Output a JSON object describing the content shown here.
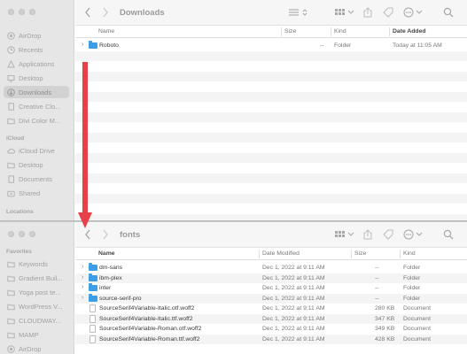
{
  "colors": {
    "accent": "#3d9de6",
    "arrow": "#e8404a",
    "selected_bg": "#d2d2d2"
  },
  "window1": {
    "title": "Downloads",
    "sidebar": {
      "items": [
        {
          "label": "AirDrop",
          "icon": "airdrop-icon"
        },
        {
          "label": "Recents",
          "icon": "clock-icon"
        },
        {
          "label": "Applications",
          "icon": "applications-icon"
        },
        {
          "label": "Desktop",
          "icon": "desktop-icon"
        },
        {
          "label": "Downloads",
          "icon": "download-icon",
          "selected": true
        },
        {
          "label": "Creative Clo...",
          "icon": "document-icon"
        },
        {
          "label": "Divi Color M...",
          "icon": "folder-icon"
        }
      ],
      "icloud_header": "iCloud",
      "icloud_items": [
        {
          "label": "iCloud Drive",
          "icon": "cloud-icon"
        },
        {
          "label": "Desktop",
          "icon": "folder-icon"
        },
        {
          "label": "Documents",
          "icon": "document-icon"
        },
        {
          "label": "Shared",
          "icon": "shared-folder-icon"
        }
      ],
      "locations_header": "Locations"
    },
    "columns": {
      "name": "Name",
      "size": "Size",
      "kind": "Kind",
      "date_added": "Date Added"
    },
    "rows": [
      {
        "name": "Roboto",
        "size": "--",
        "kind": "Folder",
        "date": "Today at 11:05 AM",
        "type": "folder"
      }
    ]
  },
  "window2": {
    "title": "fonts",
    "sidebar": {
      "favorites_header": "Favorites",
      "items": [
        {
          "label": "Keywords",
          "icon": "folder-icon"
        },
        {
          "label": "Gradient Buil...",
          "icon": "folder-icon"
        },
        {
          "label": "Yoga post te...",
          "icon": "folder-icon"
        },
        {
          "label": "WordPress V...",
          "icon": "folder-icon"
        },
        {
          "label": "CLOUDWAY...",
          "icon": "folder-icon"
        },
        {
          "label": "MAMP",
          "icon": "folder-icon"
        },
        {
          "label": "AirDrop",
          "icon": "airdrop-icon"
        }
      ]
    },
    "columns": {
      "name": "Name",
      "date_modified": "Date Modified",
      "size": "Size",
      "kind": "Kind"
    },
    "rows": [
      {
        "name": "dm-sans",
        "date": "Dec 1, 2022 at 9:11 AM",
        "size": "--",
        "kind": "Folder",
        "type": "folder"
      },
      {
        "name": "ibm-plex",
        "date": "Dec 1, 2022 at 9:11 AM",
        "size": "--",
        "kind": "Folder",
        "type": "folder"
      },
      {
        "name": "inter",
        "date": "Dec 1, 2022 at 9:11 AM",
        "size": "--",
        "kind": "Folder",
        "type": "folder"
      },
      {
        "name": "source-serif-pro",
        "date": "Dec 1, 2022 at 9:11 AM",
        "size": "--",
        "kind": "Folder",
        "type": "folder"
      },
      {
        "name": "SourceSerif4Variable-Italic.otf.woff2",
        "date": "Dec 1, 2022 at 9:11 AM",
        "size": "280 KB",
        "kind": "Document",
        "type": "doc"
      },
      {
        "name": "SourceSerif4Variable-Italic.ttf.woff2",
        "date": "Dec 1, 2022 at 9:11 AM",
        "size": "347 KB",
        "kind": "Document",
        "type": "doc"
      },
      {
        "name": "SourceSerif4Variable-Roman.otf.woff2",
        "date": "Dec 1, 2022 at 9:11 AM",
        "size": "349 KB",
        "kind": "Document",
        "type": "doc"
      },
      {
        "name": "SourceSerif4Variable-Roman.ttf.woff2",
        "date": "Dec 1, 2022 at 9:11 AM",
        "size": "428 KB",
        "kind": "Document",
        "type": "doc"
      }
    ]
  }
}
